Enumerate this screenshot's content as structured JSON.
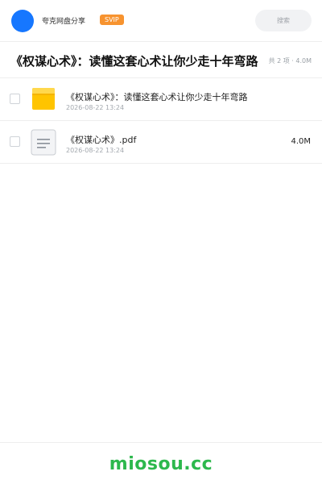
{
  "header": {
    "brand": "夸克网盘分享",
    "badge": "SVIP",
    "search_label": "搜索",
    "avatar_icon": "user-avatar-circle",
    "avatar_color": "#1677ff",
    "badge_color": "#f7932f"
  },
  "share": {
    "title": "《权谋心术》：读懂这套心术让你少走十年弯路",
    "meta": "共 2 项 · 4.0M"
  },
  "files": [
    {
      "name": "《权谋心术》：读懂这套心术让你少走十年弯路",
      "date": "2026-08-22 13:24",
      "size": "",
      "icon": "folder-icon"
    },
    {
      "name": "《权谋心术》.pdf",
      "date": "2026-08-22 13:24",
      "size": "4.0M",
      "icon": "document-icon"
    }
  ],
  "footer": {
    "logo": "miosou.cc",
    "logo_color": "#2db84d"
  }
}
